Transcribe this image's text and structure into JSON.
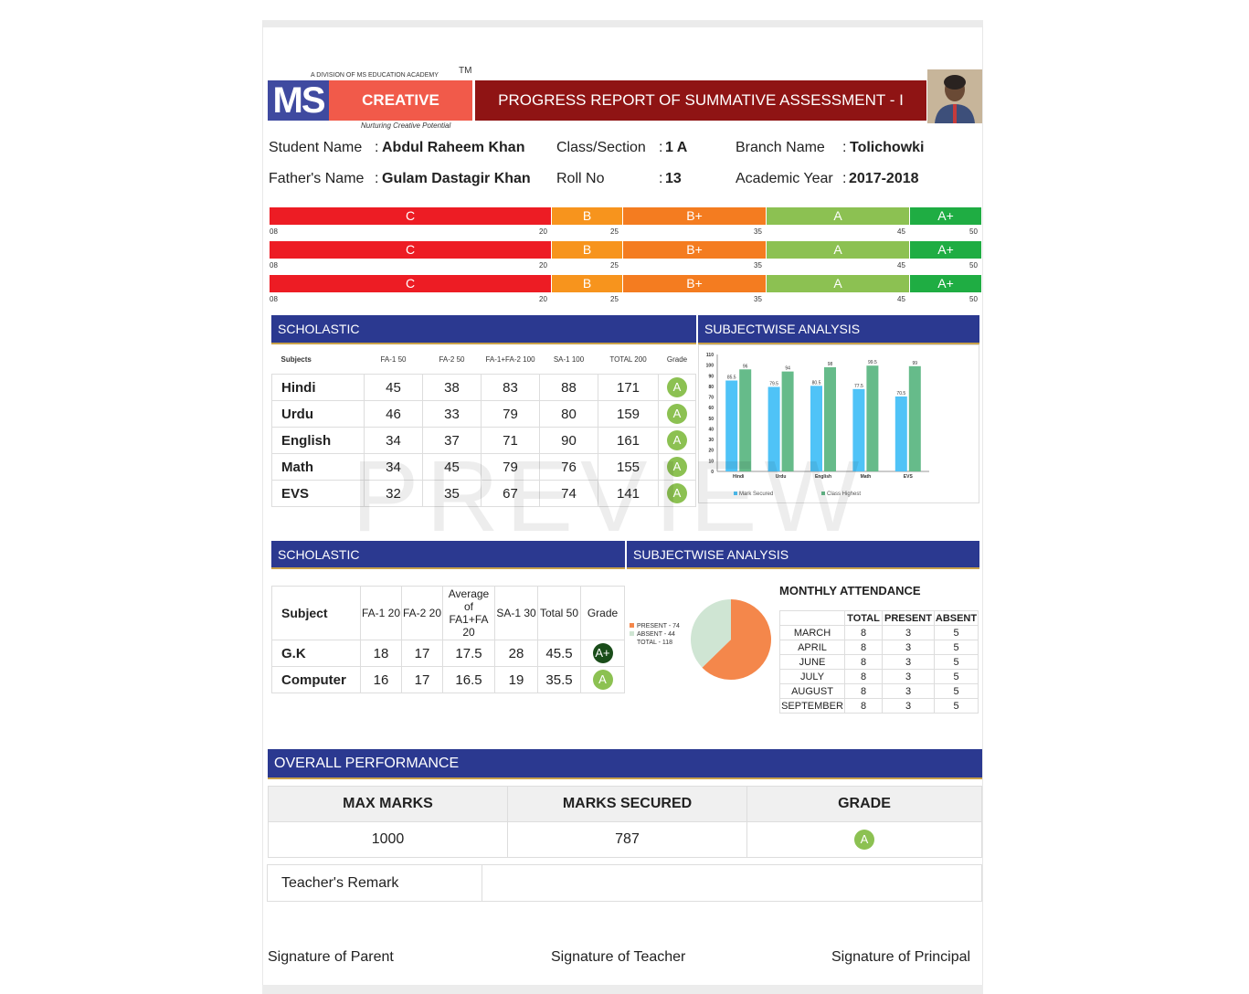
{
  "school": {
    "division": "A DIVISION OF MS EDUCATION ACADEMY",
    "tm": "TM",
    "logo_ms": "MS",
    "logo_name": "CREATIVE SCHOOL",
    "tagline": "Nurturing Creative Potential"
  },
  "report_title": "PROGRESS REPORT OF SUMMATIVE ASSESSMENT - I",
  "student": {
    "name_label": "Student Name",
    "name": "Abdul Raheem Khan",
    "class_label": "Class/Section",
    "class": "1 A",
    "branch_label": "Branch Name",
    "branch": "Tolichowki",
    "father_label": "Father's Name",
    "father": "Gulam Dastagir Khan",
    "roll_label": "Roll No",
    "roll": "13",
    "year_label": "Academic Year",
    "year": "2017-2018",
    "sep": ":"
  },
  "grade_scale": {
    "labels": [
      "C",
      "B",
      "B+",
      "A",
      "A+"
    ],
    "ticks": [
      "08",
      "20",
      "25",
      "35",
      "45",
      "50"
    ],
    "colors": [
      "#ed1c24",
      "#f7941d",
      "#f47c20",
      "#8cc152",
      "#1fad43"
    ]
  },
  "scholastic1": {
    "header": "SCHOLASTIC",
    "columns": [
      "Subjects",
      "FA-1 50",
      "FA-2 50",
      "FA-1+FA-2 100",
      "SA-1 100",
      "TOTAL 200",
      "Grade"
    ],
    "rows": [
      {
        "subject": "Hindi",
        "fa1": "45",
        "fa2": "38",
        "fa12": "83",
        "sa1": "88",
        "total": "171",
        "grade": "A"
      },
      {
        "subject": "Urdu",
        "fa1": "46",
        "fa2": "33",
        "fa12": "79",
        "sa1": "80",
        "total": "159",
        "grade": "A"
      },
      {
        "subject": "English",
        "fa1": "34",
        "fa2": "37",
        "fa12": "71",
        "sa1": "90",
        "total": "161",
        "grade": "A"
      },
      {
        "subject": "Math",
        "fa1": "34",
        "fa2": "45",
        "fa12": "79",
        "sa1": "76",
        "total": "155",
        "grade": "A"
      },
      {
        "subject": "EVS",
        "fa1": "32",
        "fa2": "35",
        "fa12": "67",
        "sa1": "74",
        "total": "141",
        "grade": "A"
      }
    ]
  },
  "analysis1": {
    "header": "SUBJECTWISE ANALYSIS"
  },
  "chart_data": [
    {
      "type": "bar",
      "categories": [
        "Hindi",
        "Urdu",
        "English",
        "Math",
        "EVS"
      ],
      "series": [
        {
          "name": "Mark Secured",
          "values": [
            85.5,
            79.5,
            80.5,
            77.5,
            70.5
          ],
          "color": "#4fc3f7"
        },
        {
          "name": "Class Highest",
          "values": [
            96,
            94,
            98,
            99.5,
            99
          ],
          "color": "#66bb8a"
        }
      ],
      "ylim": [
        0,
        110
      ],
      "yticks": [
        0,
        10,
        20,
        30,
        40,
        50,
        60,
        70,
        80,
        90,
        100,
        110
      ],
      "legend": "bottom"
    },
    {
      "type": "pie",
      "labels": [
        "PRESENT - 74",
        "ABSENT - 44"
      ],
      "values": [
        74,
        44
      ],
      "colors": [
        "#f4874b",
        "#cfe5d3"
      ],
      "total_label": "TOTAL - 118",
      "legend": "left"
    }
  ],
  "scholastic2": {
    "header": "SCHOLASTIC",
    "columns": [
      "Subject",
      "FA-1 20",
      "FA-2 20",
      "Average of FA1+FA 20",
      "SA-1 30",
      "Total 50",
      "Grade"
    ],
    "rows": [
      {
        "subject": "G.K",
        "fa1": "18",
        "fa2": "17",
        "avg": "17.5",
        "sa1": "28",
        "total": "45.5",
        "grade": "A+"
      },
      {
        "subject": "Computer",
        "fa1": "16",
        "fa2": "17",
        "avg": "16.5",
        "sa1": "19",
        "total": "35.5",
        "grade": "A"
      }
    ]
  },
  "analysis2": {
    "header": "SUBJECTWISE ANALYSIS"
  },
  "attendance": {
    "title": "MONTHLY ATTENDANCE",
    "columns": [
      "",
      "TOTAL",
      "PRESENT",
      "ABSENT"
    ],
    "rows": [
      {
        "month": "MARCH",
        "total": "8",
        "present": "3",
        "absent": "5"
      },
      {
        "month": "APRIL",
        "total": "8",
        "present": "3",
        "absent": "5"
      },
      {
        "month": "JUNE",
        "total": "8",
        "present": "3",
        "absent": "5"
      },
      {
        "month": "JULY",
        "total": "8",
        "present": "3",
        "absent": "5"
      },
      {
        "month": "AUGUST",
        "total": "8",
        "present": "3",
        "absent": "5"
      },
      {
        "month": "SEPTEMBER",
        "total": "8",
        "present": "3",
        "absent": "5"
      }
    ]
  },
  "overall": {
    "header": "OVERALL PERFORMANCE",
    "max_label": "MAX MARKS",
    "secured_label": "MARKS SECURED",
    "grade_label": "GRADE",
    "max": "1000",
    "secured": "787",
    "grade": "A"
  },
  "remark_label": "Teacher's Remark",
  "signatures": {
    "parent": "Signature of Parent",
    "teacher": "Signature of Teacher",
    "principal": "Signature of Principal"
  },
  "watermark": "PREVIEW"
}
